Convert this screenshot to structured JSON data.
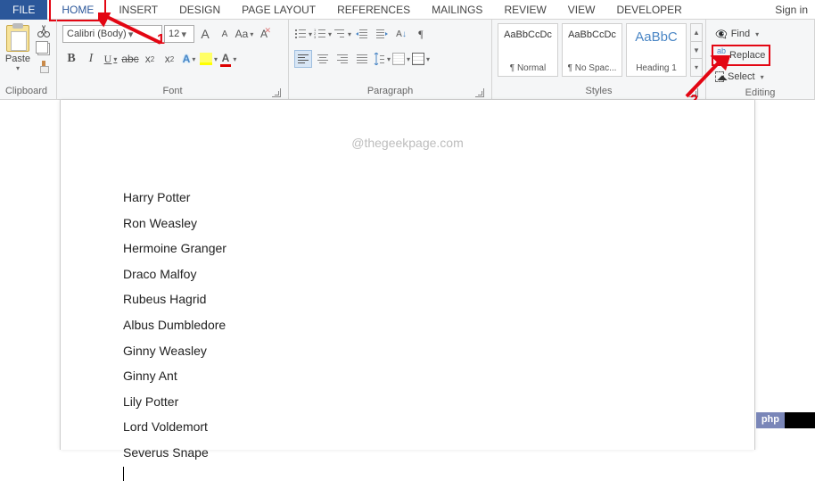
{
  "tabs": {
    "file": "FILE",
    "home": "HOME",
    "insert": "INSERT",
    "design": "DESIGN",
    "page_layout": "PAGE LAYOUT",
    "references": "REFERENCES",
    "mailings": "MAILINGS",
    "review": "REVIEW",
    "view": "VIEW",
    "developer": "DEVELOPER",
    "signin": "Sign in"
  },
  "clipboard": {
    "label": "Clipboard",
    "paste": "Paste"
  },
  "font": {
    "label": "Font",
    "name": "Calibri (Body)",
    "size": "12",
    "grow": "A",
    "shrink": "A",
    "changecase": "Aa",
    "bold": "B",
    "italic": "I",
    "underline": "U",
    "strike": "abc",
    "sub": "x",
    "sup": "x",
    "texteffects": "A",
    "highlight": "",
    "fontcolor": "A"
  },
  "paragraph": {
    "label": "Paragraph"
  },
  "styles": {
    "label": "Styles",
    "preview": "AaBbCcDc",
    "preview_h": "AaBbC",
    "items": [
      {
        "name": "¶ Normal"
      },
      {
        "name": "¶ No Spac..."
      },
      {
        "name": "Heading 1"
      }
    ]
  },
  "editing": {
    "label": "Editing",
    "find": "Find",
    "replace": "Replace",
    "select": "Select"
  },
  "annotation": {
    "n1": "1",
    "n2": "2"
  },
  "doc": {
    "watermark": "@thegeekpage.com",
    "lines": [
      "Harry Potter",
      "Ron Weasley",
      "Hermoine Granger",
      "Draco Malfoy",
      "Rubeus Hagrid",
      "Albus Dumbledore",
      "Ginny Weasley",
      "Ginny Ant",
      "Lily Potter",
      "Lord Voldemort",
      "Severus Snape"
    ]
  },
  "badge": {
    "text": "php"
  }
}
